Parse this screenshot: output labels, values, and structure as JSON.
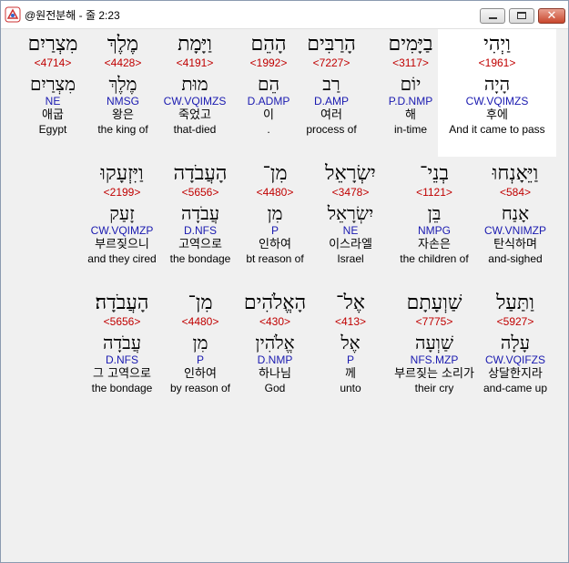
{
  "window": {
    "title": "@원전분해 - 줄 2:23",
    "icon": "app-logo-icon",
    "buttons": [
      "minimize",
      "maximize",
      "close"
    ],
    "close_glyph": "✕"
  },
  "rows": [
    [
      {
        "heb": "וַיְהִי",
        "strong": "<1961>",
        "root": "הָיָה",
        "parse": "CW.VQIMZS",
        "kor": "후에",
        "eng": "And it came to pass"
      },
      {
        "heb": "בַיָּמִים",
        "strong": "<3117>",
        "root": "יוֹם",
        "parse": "P.D.NMP",
        "kor": "해",
        "eng": "in-time"
      },
      {
        "heb": "הָרַבִּים",
        "strong": "<7227>",
        "root": "רַב",
        "parse": "D.AMP",
        "kor": "여러",
        "eng": "process of"
      },
      {
        "heb": "הָהֵם",
        "strong": "<1992>",
        "root": "הֵם",
        "parse": "D.ADMP",
        "kor": "이",
        "eng": "."
      },
      {
        "heb": "וַיָּמָת",
        "strong": "<4191>",
        "root": "מוּת",
        "parse": "CW.VQIMZS",
        "kor": "죽었고",
        "eng": "that-died"
      },
      {
        "heb": "מֶלֶךְ",
        "strong": "<4428>",
        "root": "מֶלֶךְ",
        "parse": "NMSG",
        "kor": "왕은",
        "eng": "the king of"
      },
      {
        "heb": "מִצְרַיִם",
        "strong": "<4714>",
        "root": "מִצְרַיִם",
        "parse": "NE",
        "kor": "애굽",
        "eng": "Egypt"
      }
    ],
    [
      {
        "heb": "וַיֵּאָנְחוּ",
        "strong": "<584>",
        "root": "אָנַח",
        "parse": "CW.VNIMZP",
        "kor": "탄식하며",
        "eng": "and-sighed"
      },
      {
        "heb": "בְנֵי־",
        "strong": "<1121>",
        "root": "בֵּן",
        "parse": "NMPG",
        "kor": "자손은",
        "eng": "the children of"
      },
      {
        "heb": "יִשְׂרָאֵל",
        "strong": "<3478>",
        "root": "יִשְׂרָאֵל",
        "parse": "NE",
        "kor": "이스라엘",
        "eng": "Israel"
      },
      {
        "heb": "מִן־",
        "strong": "<4480>",
        "root": "מִן",
        "parse": "P",
        "kor": "인하여",
        "eng": "bt reason of"
      },
      {
        "heb": "הָעֲבֹדָה",
        "strong": "<5656>",
        "root": "עֲבֹדָה",
        "parse": "D.NFS",
        "kor": "고역으로",
        "eng": "the bondage"
      },
      {
        "heb": "וַיִּזְעָקוּ",
        "strong": "<2199>",
        "root": "זָעַק",
        "parse": "CW.VQIMZP",
        "kor": "부르짖으니",
        "eng": "and they cired"
      }
    ],
    [
      {
        "heb": "וַתַּעַל",
        "strong": "<5927>",
        "root": "עָלָה",
        "parse": "CW.VQIFZS",
        "kor": "상달한지라",
        "eng": "and-came up"
      },
      {
        "heb": "שַׁוְעָתָם",
        "strong": "<7775>",
        "root": "שַׁוְעָה",
        "parse": "NFS.MZP",
        "kor": "부르짖는 소리가",
        "eng": "their cry"
      },
      {
        "heb": "אֶל־",
        "strong": "<413>",
        "root": "אֶל",
        "parse": "P",
        "kor": "께",
        "eng": "unto"
      },
      {
        "heb": "הָאֱלֹהִים",
        "strong": "<430>",
        "root": "אֱלֹהִין",
        "parse": "D.NMP",
        "kor": "하나님",
        "eng": "God"
      },
      {
        "heb": "מִן־",
        "strong": "<4480>",
        "root": "מִן",
        "parse": "P",
        "kor": "인하여",
        "eng": "by reason of"
      },
      {
        "heb": "הָעֲבֹדָה׃",
        "strong": "<5656>",
        "root": "עֲבֹדָה",
        "parse": "D.NFS",
        "kor": "그 고역으로",
        "eng": "the bondage"
      }
    ]
  ]
}
